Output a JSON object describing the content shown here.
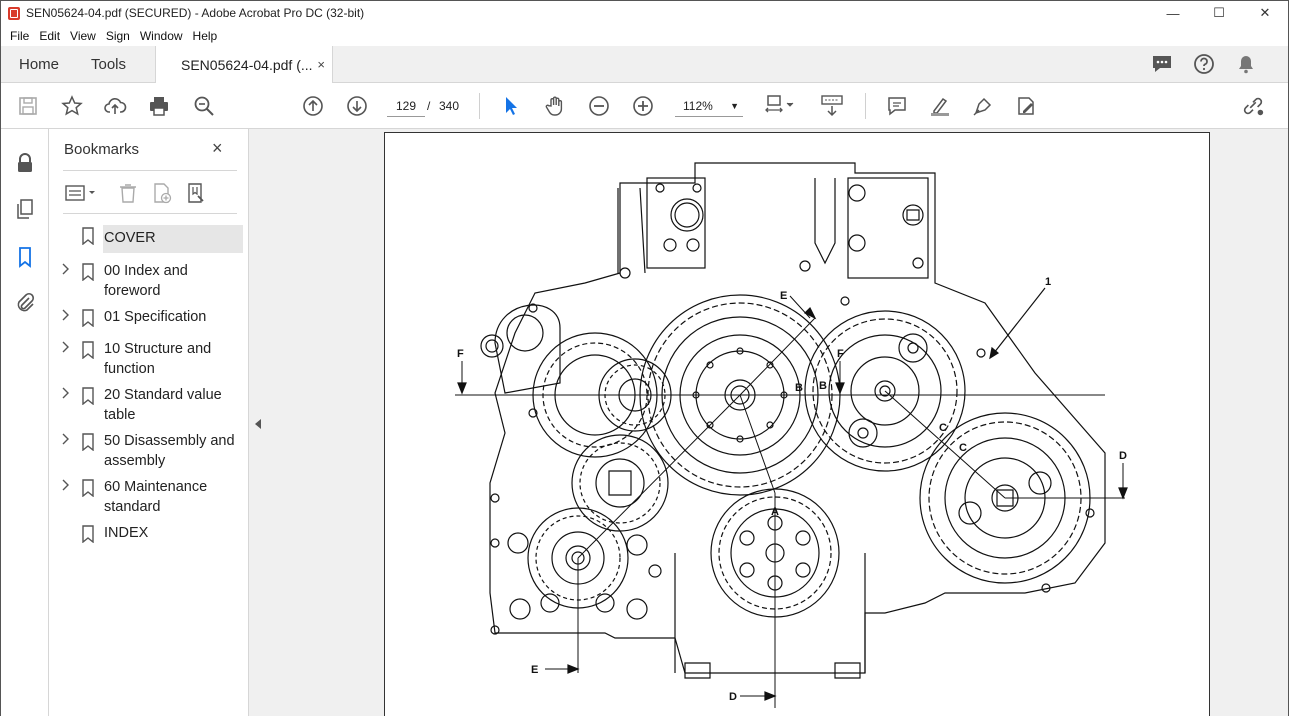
{
  "window": {
    "title": "SEN05624-04.pdf (SECURED) - Adobe Acrobat Pro DC (32-bit)",
    "minimize": "—",
    "maximize": "☐",
    "close": "✕"
  },
  "menu": [
    "File",
    "Edit",
    "View",
    "Sign",
    "Window",
    "Help"
  ],
  "tabs": {
    "home": "Home",
    "tools": "Tools",
    "document": "SEN05624-04.pdf (...",
    "close": "×"
  },
  "toolbar": {
    "current_page": "129",
    "page_separator": "/",
    "total_pages": "340",
    "zoom": "112%"
  },
  "bookmarks": {
    "title": "Bookmarks",
    "close": "×",
    "items": [
      {
        "label": "COVER",
        "expandable": false,
        "selected": true
      },
      {
        "label": "00 Index and foreword",
        "expandable": true
      },
      {
        "label": "01 Specification",
        "expandable": true
      },
      {
        "label": "10 Structure and function",
        "expandable": true
      },
      {
        "label": "20 Standard value table",
        "expandable": true
      },
      {
        "label": "50 Disassembly and assembly",
        "expandable": true
      },
      {
        "label": "60 Maintenance standard",
        "expandable": true
      },
      {
        "label": "INDEX",
        "expandable": false
      }
    ]
  },
  "drawing": {
    "labels": {
      "one": "1",
      "a": "A",
      "b1": "B",
      "b2": "B",
      "c1": "C",
      "c2": "C",
      "d_top": "D",
      "d_bottom": "D",
      "e_top": "E",
      "e_bottom": "E",
      "f_left": "F",
      "f_mid": "F"
    }
  },
  "colors": {
    "accent": "#1473e6",
    "app_icon": "#d83b2b"
  }
}
